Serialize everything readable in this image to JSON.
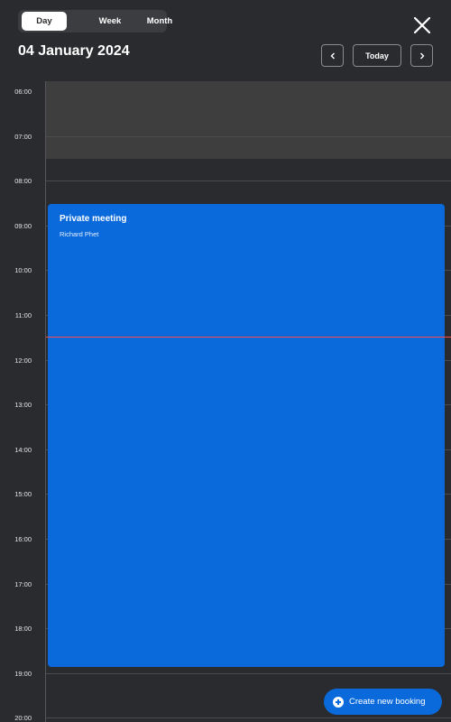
{
  "view_switch": {
    "tabs": [
      "Day",
      "Week",
      "Month"
    ],
    "active": "Day"
  },
  "header": {
    "date_title": "04 January 2024",
    "today_label": "Today"
  },
  "timeline": {
    "hours": [
      "06:00",
      "07:00",
      "08:00",
      "09:00",
      "10:00",
      "11:00",
      "12:00",
      "13:00",
      "14:00",
      "15:00",
      "16:00",
      "17:00",
      "18:00",
      "19:00",
      "20:00"
    ],
    "unavailable_range": [
      "06:00",
      "07:30"
    ],
    "current_time": "11:28"
  },
  "event": {
    "title": "Private meeting",
    "organizer": "Richard Phet",
    "start": "08:30",
    "end": "18:50",
    "color": "#0a6adc"
  },
  "actions": {
    "create_booking_label": "Create new booking"
  },
  "icons": {
    "close": "close-icon",
    "prev": "chevron-left-icon",
    "next": "chevron-right-icon",
    "add": "plus-circle-icon"
  }
}
